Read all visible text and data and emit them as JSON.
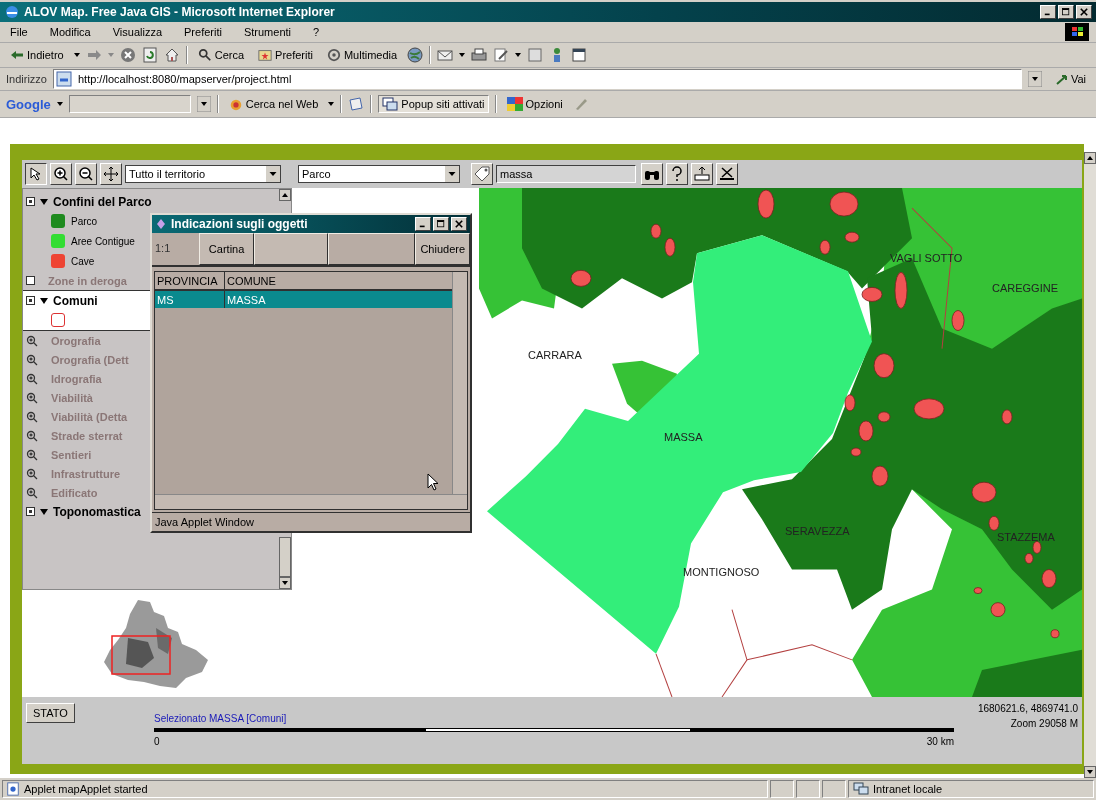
{
  "window": {
    "title": "ALOV Map. Free Java GIS - Microsoft Internet Explorer"
  },
  "menu": [
    "File",
    "Modifica",
    "Visualizza",
    "Preferiti",
    "Strumenti",
    "?"
  ],
  "toolbar": {
    "back": "Indietro",
    "search": "Cerca",
    "favorites": "Preferiti",
    "media": "Multimedia"
  },
  "address_bar": {
    "label": "Indirizzo",
    "url": "http://localhost:8080/mapserver/project.html",
    "go": "Vai"
  },
  "google_bar": {
    "logo": "Google",
    "search_button": "Cerca nel Web",
    "popup_blocker": "Popup siti attivati",
    "options": "Opzioni"
  },
  "applet": {
    "toolbar": {
      "extent": "Tutto il territorio",
      "layer": "Parco",
      "search_value": "massa"
    },
    "layers": [
      {
        "kind": "group",
        "label": "Confini del Parco",
        "checked": true,
        "expanded": true,
        "selected": false,
        "legend": [
          {
            "kind": "fill",
            "label": "Parco",
            "color": "#1e8a1e"
          },
          {
            "kind": "fill",
            "label": "Aree Contigue",
            "color": "#33dd33"
          },
          {
            "kind": "fill",
            "label": "Cave",
            "color": "#ee4433"
          }
        ]
      },
      {
        "kind": "toggle",
        "label": "Zone in deroga",
        "checked": false
      },
      {
        "kind": "group",
        "label": "Comuni",
        "checked": true,
        "expanded": true,
        "selected": true,
        "legend": [
          {
            "kind": "outline",
            "color": "#dd3333"
          }
        ]
      },
      {
        "kind": "scale",
        "label": "Orografia"
      },
      {
        "kind": "scale",
        "label": "Orografia (Dett"
      },
      {
        "kind": "scale",
        "label": "Idrografia"
      },
      {
        "kind": "scale",
        "label": "Viabilità"
      },
      {
        "kind": "scale",
        "label": "Viabilità (Detta"
      },
      {
        "kind": "scale",
        "label": "Strade sterrat"
      },
      {
        "kind": "scale",
        "label": "Sentieri"
      },
      {
        "kind": "scale",
        "label": "Infrastrutture"
      },
      {
        "kind": "scale",
        "label": "Edificato"
      },
      {
        "kind": "group",
        "label": "Toponomastica",
        "checked": true,
        "expanded": true,
        "selected": false
      }
    ],
    "map": {
      "labels": [
        "CARRARA",
        "MASSA",
        "VAGLI SOTTO",
        "CAREGGINE",
        "SERAVEZZA",
        "STAZZEMA",
        "MONTIGNOSO"
      ]
    },
    "status": {
      "button": "STATO",
      "selection": "Selezionato MASSA [Comuni]",
      "scale_start": "0",
      "scale_end": "30 km",
      "coordinates": "1680621.6, 4869741.0",
      "zoom": "Zoom  29058 M"
    }
  },
  "popup": {
    "title": "Indicazioni sugli oggetti",
    "scale": "1:1",
    "map_button": "Cartina",
    "close_button": "Chiudere",
    "columns": [
      "PROVINCIA",
      "COMUNE"
    ],
    "rows": [
      {
        "cells": [
          "MS",
          "MASSA"
        ],
        "selected": true
      }
    ],
    "footer": "Java Applet Window"
  },
  "status_bar": {
    "text": "Applet mapApplet started",
    "zone": "Intranet locale"
  }
}
